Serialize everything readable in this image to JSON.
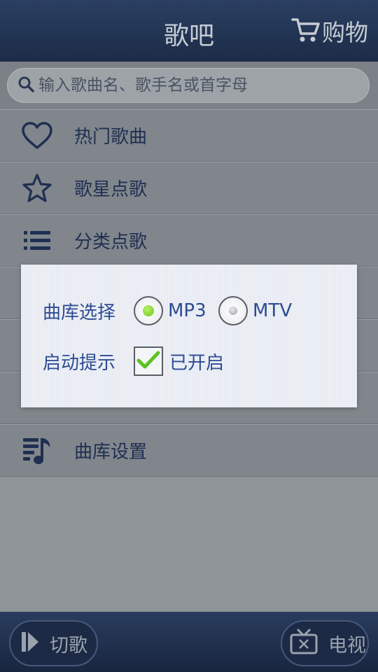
{
  "header": {
    "title": "歌吧",
    "cart_label": "购物",
    "cart_icon": "cart-icon"
  },
  "search": {
    "placeholder": "输入歌曲名、歌手名或首字母",
    "icon": "search-icon"
  },
  "menu": {
    "items": [
      {
        "label": "热门歌曲",
        "icon": "heart-icon"
      },
      {
        "label": "歌星点歌",
        "icon": "star-icon"
      },
      {
        "label": "分类点歌",
        "icon": "list-icon"
      },
      {
        "label": "",
        "icon": ""
      },
      {
        "label": "",
        "icon": ""
      },
      {
        "label": "",
        "icon": ""
      },
      {
        "label": "曲库设置",
        "icon": "music-library-icon"
      }
    ]
  },
  "dialog": {
    "library_label": "曲库选择",
    "options": [
      {
        "label": "MP3",
        "selected": true
      },
      {
        "label": "MTV",
        "selected": false
      }
    ],
    "startup_label": "启动提示",
    "startup_checked": true,
    "startup_status": "已开启"
  },
  "bottom": {
    "skip_label": "切歌",
    "tv_label": "电视"
  },
  "colors": {
    "header": "#1c2c48",
    "accent_text": "#2c4c93",
    "radio_selected": "#7ad520",
    "check": "#5cc21e"
  }
}
